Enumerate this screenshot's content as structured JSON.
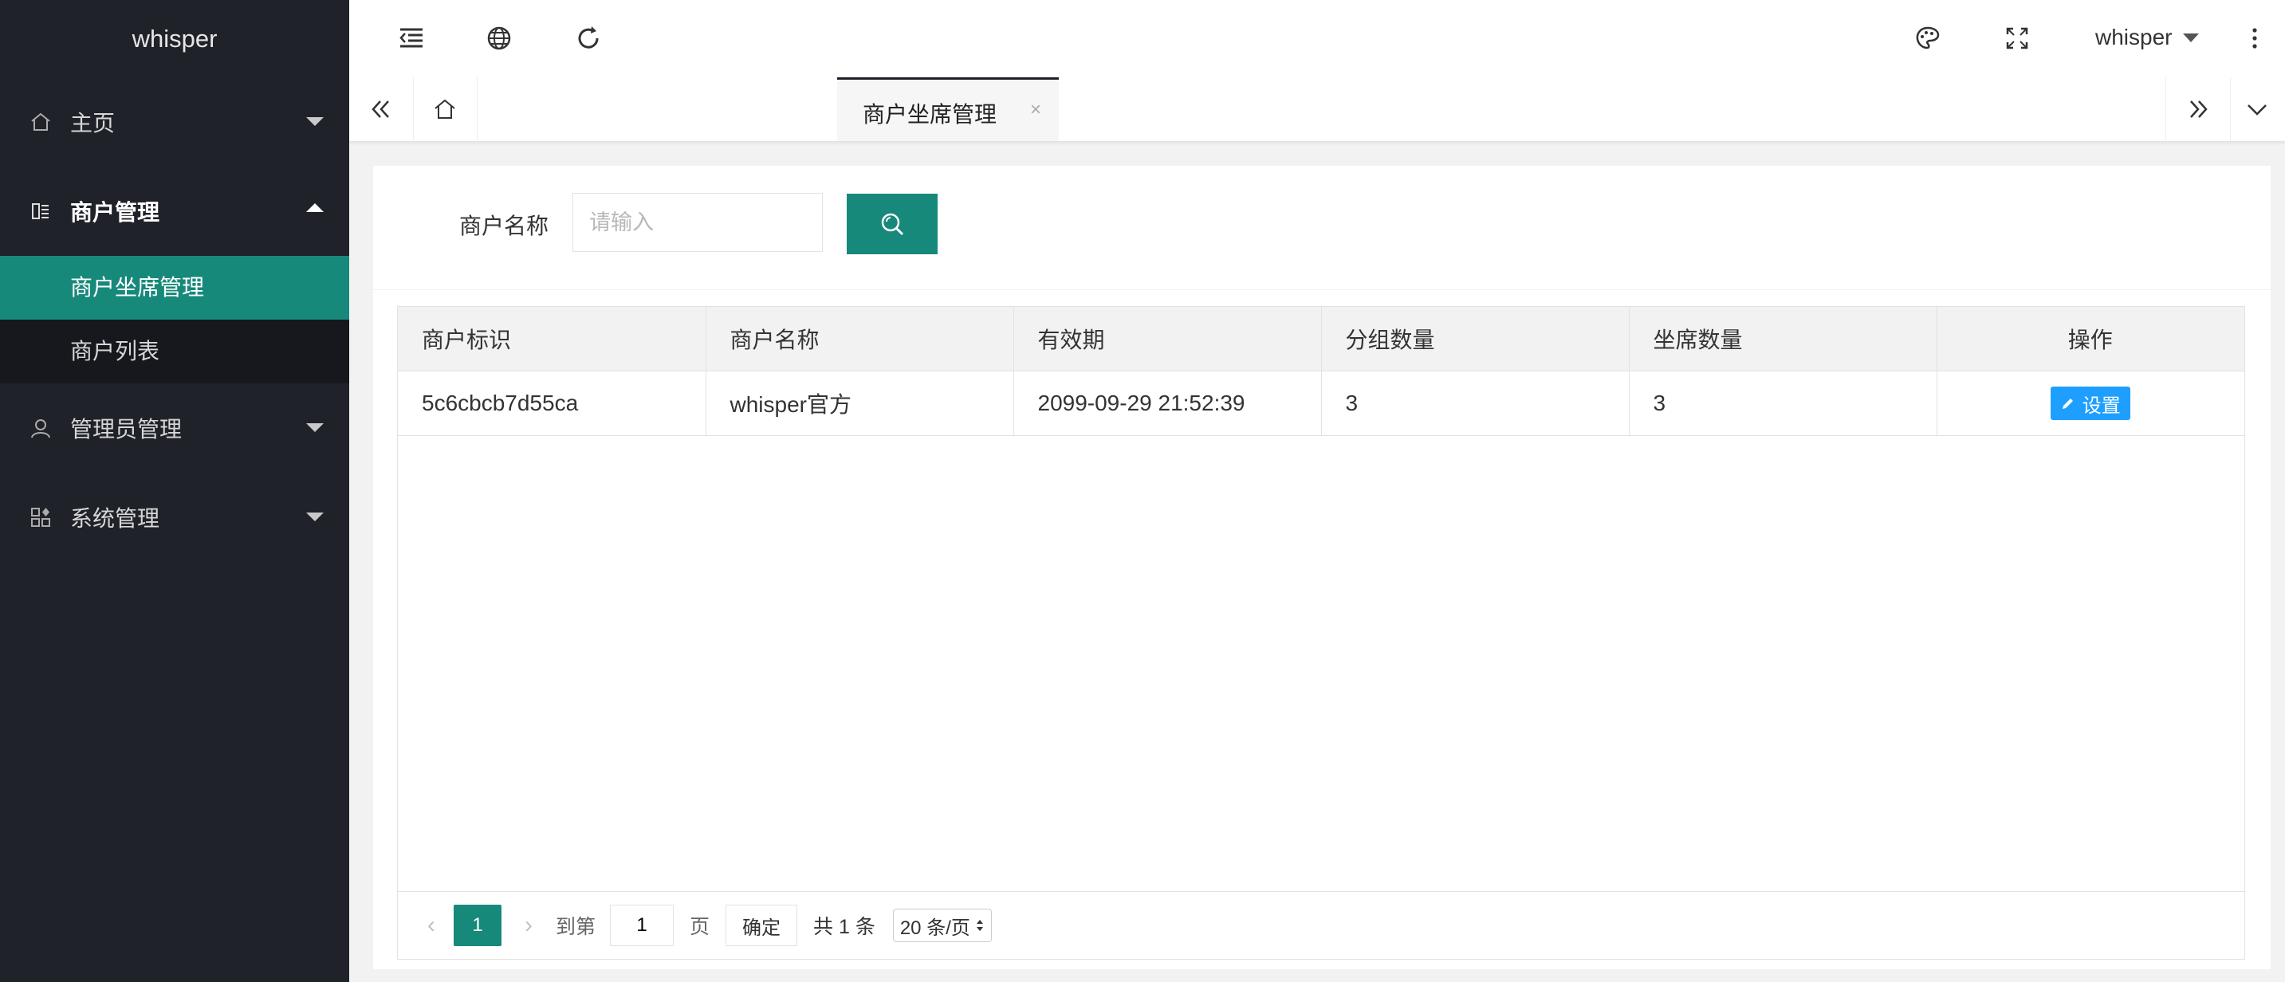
{
  "app_title": "whisper",
  "sidebar": {
    "items": [
      {
        "label": "主页",
        "icon": "home-icon",
        "expanded": false
      },
      {
        "label": "商户管理",
        "icon": "merchant-icon",
        "expanded": true,
        "children": [
          {
            "label": "商户坐席管理",
            "active": true
          },
          {
            "label": "商户列表",
            "active": false
          }
        ]
      },
      {
        "label": "管理员管理",
        "icon": "admin-user-icon",
        "expanded": false
      },
      {
        "label": "系统管理",
        "icon": "system-grid-icon",
        "expanded": false
      }
    ]
  },
  "header": {
    "icons": [
      "menu-collapse-icon",
      "globe-icon",
      "refresh-icon",
      "theme-palette-icon",
      "fullscreen-icon",
      "more-vertical-icon"
    ],
    "user": "whisper"
  },
  "tabs": {
    "active_label": "商户坐席管理",
    "close_glyph": "×"
  },
  "search": {
    "label": "商户名称",
    "placeholder": "请输入"
  },
  "table": {
    "headers": [
      "商户标识",
      "商户名称",
      "有效期",
      "分组数量",
      "坐席数量",
      "操作"
    ],
    "rows": [
      [
        "5c6cbcb7d55ca",
        "whisper官方",
        "2099-09-29 21:52:39",
        "3",
        "3"
      ]
    ],
    "action_label": "设置"
  },
  "pagination": {
    "current_page": "1",
    "goto_label": "到第",
    "goto_value": "1",
    "page_unit": "页",
    "confirm_label": "确定",
    "total_text": "共 1 条",
    "page_size": "20 条/页"
  },
  "colors": {
    "sidebar_bg": "#20222a",
    "accent": "#16897a",
    "action_button": "#1e9fff"
  }
}
